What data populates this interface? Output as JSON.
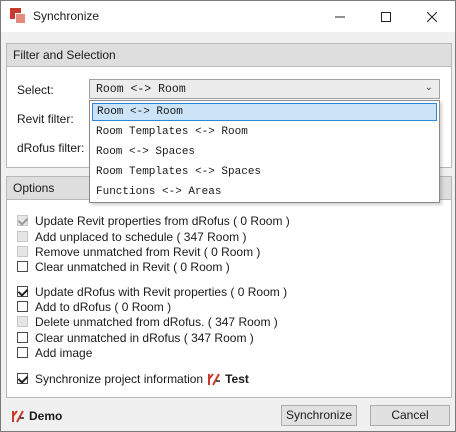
{
  "window": {
    "title": "Synchronize"
  },
  "filter_group": {
    "header": "Filter and Selection",
    "select_label": "Select:",
    "revit_filter_label": "Revit filter:",
    "drofus_filter_label": "dRofus filter:",
    "select_value": "Room <-> Room",
    "options": [
      "Room <-> Room",
      "Room Templates <-> Room",
      "Room <-> Spaces",
      "Room Templates <-> Spaces",
      "Functions <-> Areas"
    ]
  },
  "options_group": {
    "header": "Options",
    "revit_options": [
      {
        "label": "Update Revit properties from dRofus ( 0 Room )",
        "checked": true,
        "disabled": true
      },
      {
        "label": "Add unplaced to schedule ( 347 Room )",
        "checked": false,
        "disabled": true
      },
      {
        "label": "Remove unmatched from Revit ( 0 Room )",
        "checked": false,
        "disabled": true
      },
      {
        "label": "Clear unmatched in Revit ( 0 Room )",
        "checked": false,
        "disabled": false
      }
    ],
    "drofus_options": [
      {
        "label": "Update dRofus with Revit properties ( 0 Room )",
        "checked": true,
        "disabled": false
      },
      {
        "label": "Add to dRofus ( 0 Room )",
        "checked": false,
        "disabled": false
      },
      {
        "label": "Delete unmatched from dRofus. ( 347 Room )",
        "checked": false,
        "disabled": true
      },
      {
        "label": "Clear unmatched in dRofus ( 347 Room )",
        "checked": false,
        "disabled": false
      },
      {
        "label": "Add image",
        "checked": false,
        "disabled": false
      }
    ],
    "sync_project_info": {
      "label": "Synchronize project information",
      "checked": true,
      "project_name": "Test"
    }
  },
  "footer": {
    "database": "Demo",
    "synchronize_label": "Synchronize",
    "cancel_label": "Cancel"
  },
  "colors": {
    "accent": "#2f86d6",
    "brand_red": "#c83a2b"
  }
}
